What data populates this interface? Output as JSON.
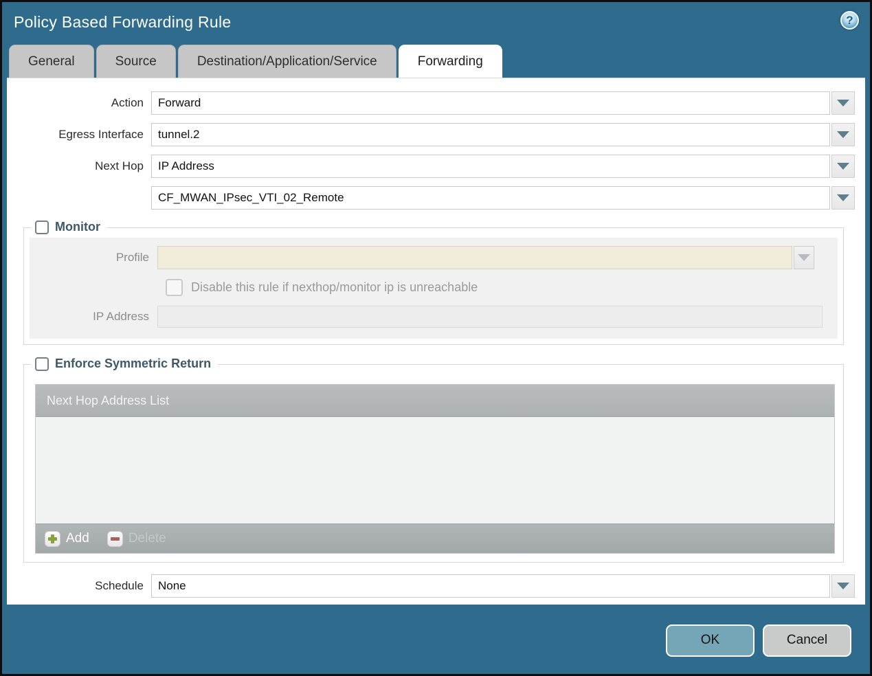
{
  "window": {
    "title": "Policy Based Forwarding Rule"
  },
  "tabs": [
    {
      "label": "General",
      "active": false
    },
    {
      "label": "Source",
      "active": false
    },
    {
      "label": "Destination/Application/Service",
      "active": false
    },
    {
      "label": "Forwarding",
      "active": true
    }
  ],
  "form": {
    "action": {
      "label": "Action",
      "value": "Forward"
    },
    "egress_interface": {
      "label": "Egress Interface",
      "value": "tunnel.2"
    },
    "next_hop": {
      "label": "Next Hop",
      "value": "IP Address"
    },
    "next_hop_address": {
      "value": "CF_MWAN_IPsec_VTI_02_Remote"
    },
    "monitor": {
      "label": "Monitor",
      "checked": false,
      "profile": {
        "label": "Profile",
        "value": ""
      },
      "disable_rule": {
        "label": "Disable this rule if nexthop/monitor ip is unreachable",
        "checked": false
      },
      "ip_address": {
        "label": "IP Address",
        "value": ""
      }
    },
    "enforce_symmetric_return": {
      "label": "Enforce Symmetric Return",
      "checked": false,
      "table": {
        "header": "Next Hop Address List",
        "rows": [],
        "add_label": "Add",
        "delete_label": "Delete"
      }
    },
    "schedule": {
      "label": "Schedule",
      "value": "None"
    }
  },
  "footer": {
    "ok_label": "OK",
    "cancel_label": "Cancel"
  },
  "icons": {
    "help": "help-icon",
    "dropdown": "chevron-down-icon",
    "add": "plus-icon",
    "delete": "minus-icon"
  },
  "colors": {
    "dialog_teal": "#2e6b8c",
    "active_tab": "#ffffff",
    "inactive_tab": "#c6c6c6",
    "disabled_field_beige": "#f1ebd9",
    "disabled_field_gray": "#ededed",
    "table_bar_gray": "#aeb3b3",
    "ok_button": "#74a6b8",
    "cancel_button": "#c9cbcb",
    "add_icon_green": "#87a23b",
    "delete_icon_red": "#a5655f",
    "section_title": "#3e586b"
  }
}
